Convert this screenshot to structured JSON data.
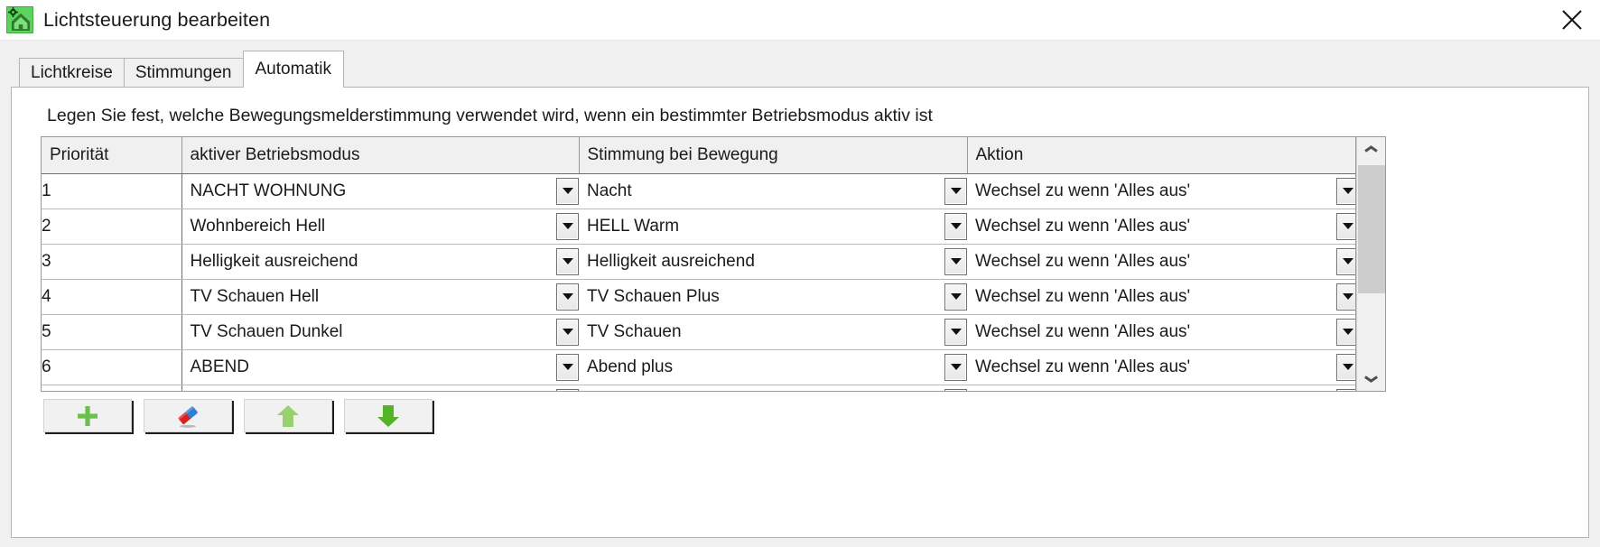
{
  "window": {
    "title": "Lichtsteuerung bearbeiten",
    "app_icon": "house-gear-icon",
    "close_label": "✕"
  },
  "tabs": [
    {
      "label": "Lichtkreise",
      "selected": false
    },
    {
      "label": "Stimmungen",
      "selected": false
    },
    {
      "label": "Automatik",
      "selected": true
    }
  ],
  "content": {
    "description": "Legen Sie fest, welche Bewegungsmelderstimmung verwendet wird, wenn ein bestimmter Betriebsmodus aktiv ist"
  },
  "table": {
    "columns": [
      "Priorität",
      "aktiver Betriebsmodus",
      "Stimmung bei Bewegung",
      "Aktion"
    ],
    "rows": [
      {
        "prioritaet": "1",
        "betriebsmodus": "NACHT WOHNUNG",
        "stimmung": "Nacht",
        "aktion": "Wechsel zu wenn 'Alles aus'"
      },
      {
        "prioritaet": "2",
        "betriebsmodus": "Wohnbereich Hell",
        "stimmung": "HELL Warm",
        "aktion": "Wechsel zu wenn 'Alles aus'"
      },
      {
        "prioritaet": "3",
        "betriebsmodus": "Helligkeit ausreichend",
        "stimmung": "Helligkeit ausreichend",
        "aktion": "Wechsel zu wenn 'Alles aus'"
      },
      {
        "prioritaet": "4",
        "betriebsmodus": "TV Schauen Hell",
        "stimmung": "TV Schauen Plus",
        "aktion": "Wechsel zu wenn 'Alles aus'"
      },
      {
        "prioritaet": "5",
        "betriebsmodus": "TV Schauen Dunkel",
        "stimmung": "TV Schauen",
        "aktion": "Wechsel zu wenn 'Alles aus'"
      },
      {
        "prioritaet": "6",
        "betriebsmodus": "ABEND",
        "stimmung": "Abend plus",
        "aktion": "Wechsel zu wenn 'Alles aus'"
      }
    ]
  },
  "scrollbar": {
    "up_icon": "chevron-up-icon",
    "down_icon": "chevron-down-icon",
    "thumb_fraction": 0.5
  },
  "toolbar": {
    "buttons": [
      {
        "name": "add-row-button",
        "icon": "plus-icon"
      },
      {
        "name": "delete-row-button",
        "icon": "eraser-icon"
      },
      {
        "name": "move-up-button",
        "icon": "arrow-up-icon"
      },
      {
        "name": "move-down-button",
        "icon": "arrow-down-icon"
      }
    ]
  },
  "colors": {
    "accent_green": "#5dd35d",
    "arrow_up_green": "#8cc867",
    "arrow_down_green": "#55b32a",
    "plus_green": "#6cbf4a",
    "eraser_blue": "#2f7fd4",
    "eraser_red": "#d9231f",
    "panel": "#f0f0f0",
    "grid_border": "#9a9a9a"
  }
}
